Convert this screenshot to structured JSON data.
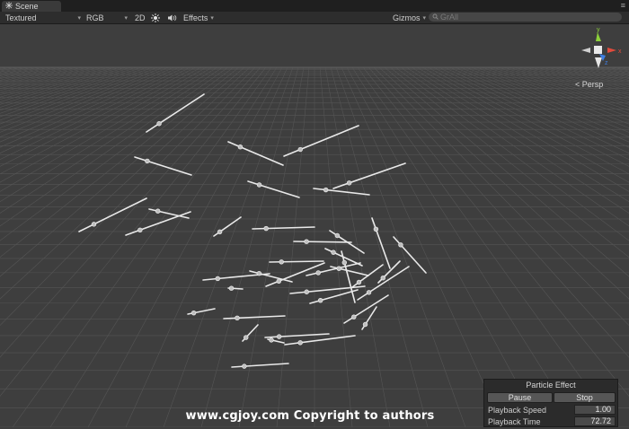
{
  "tab": {
    "title": "Scene",
    "icon": "scene-icon",
    "menu_icon": "window-menu-icon"
  },
  "toolbar": {
    "draw_mode": "Textured",
    "render_mode": "RGB",
    "mode_2d": "2D",
    "lighting_icon": "sun-icon",
    "audio_icon": "speaker-icon",
    "effects": "Effects",
    "gizmos": "Gizmos",
    "search_placeholder": "GrAll",
    "search_icon": "search-icon"
  },
  "scene": {
    "projection_label": "Persp",
    "gizmo_axes": [
      "y",
      "x",
      "z"
    ],
    "background": "#3e3e3e",
    "grid_color": "#555555"
  },
  "particle_panel": {
    "title": "Particle Effect",
    "pause_label": "Pause",
    "stop_label": "Stop",
    "rows": [
      {
        "label": "Playback Speed",
        "value": "1.00"
      },
      {
        "label": "Playback Time",
        "value": "72.72"
      }
    ]
  },
  "watermark": "www.cgjoy.com  Copyright  to  authors",
  "colors": {
    "gizmo_y": "#8dd13a",
    "gizmo_x": "#e04b3c",
    "gizmo_z": "#3f7ee0"
  }
}
